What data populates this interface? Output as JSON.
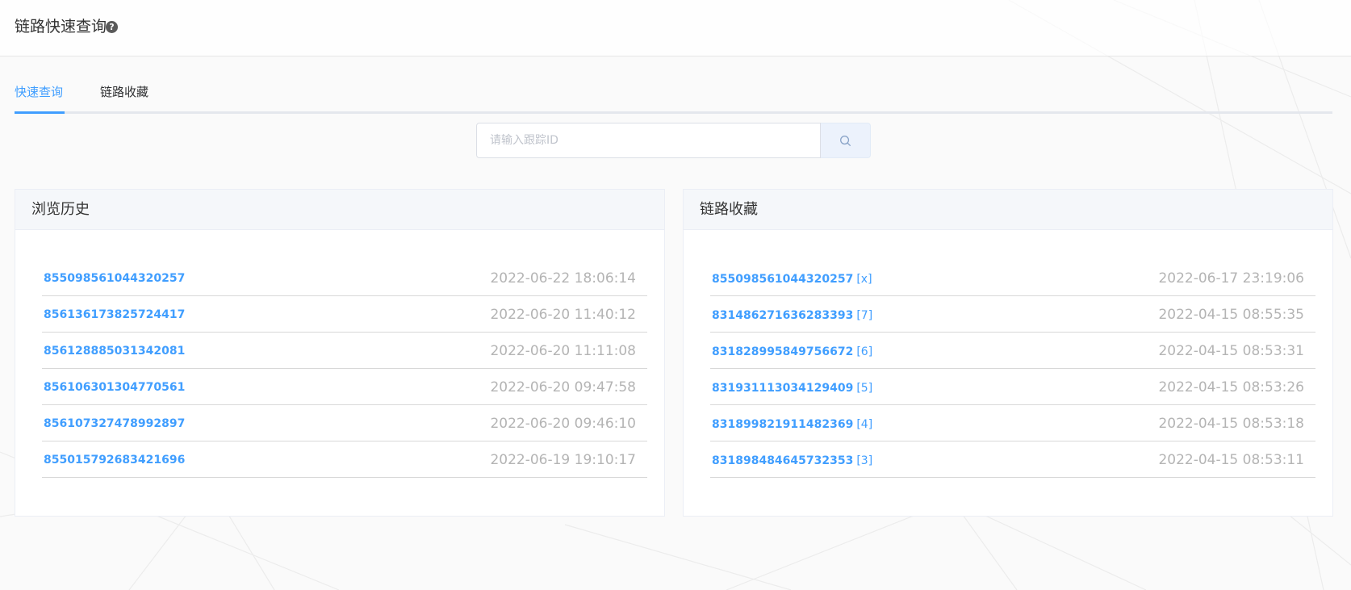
{
  "header": {
    "title": "链路快速查询",
    "help_icon": "?"
  },
  "tabs": [
    {
      "label": "快速查询",
      "active": true
    },
    {
      "label": "链路收藏",
      "active": false
    }
  ],
  "search": {
    "placeholder": "请输入跟踪ID",
    "value": "",
    "icon": "search-icon"
  },
  "history": {
    "title": "浏览历史",
    "items": [
      {
        "id": "855098561044320257",
        "time": "2022-06-22 18:06:14"
      },
      {
        "id": "856136173825724417",
        "time": "2022-06-20 11:40:12"
      },
      {
        "id": "856128885031342081",
        "time": "2022-06-20 11:11:08"
      },
      {
        "id": "856106301304770561",
        "time": "2022-06-20 09:47:58"
      },
      {
        "id": "856107327478992897",
        "time": "2022-06-20 09:46:10"
      },
      {
        "id": "855015792683421696",
        "time": "2022-06-19 19:10:17"
      }
    ]
  },
  "favorites": {
    "title": "链路收藏",
    "items": [
      {
        "id": "855098561044320257",
        "tag": "[x]",
        "time": "2022-06-17 23:19:06"
      },
      {
        "id": "831486271636283393",
        "tag": "[7]",
        "time": "2022-04-15 08:55:35"
      },
      {
        "id": "831828995849756672",
        "tag": "[6]",
        "time": "2022-04-15 08:53:31"
      },
      {
        "id": "831931113034129409",
        "tag": "[5]",
        "time": "2022-04-15 08:53:26"
      },
      {
        "id": "831899821911482369",
        "tag": "[4]",
        "time": "2022-04-15 08:53:18"
      },
      {
        "id": "831898484645732353",
        "tag": "[3]",
        "time": "2022-04-15 08:53:11"
      }
    ]
  },
  "colors": {
    "accent": "#409eff",
    "time_text": "#b4b4b4",
    "panel_header_bg": "#f5f7fa"
  }
}
